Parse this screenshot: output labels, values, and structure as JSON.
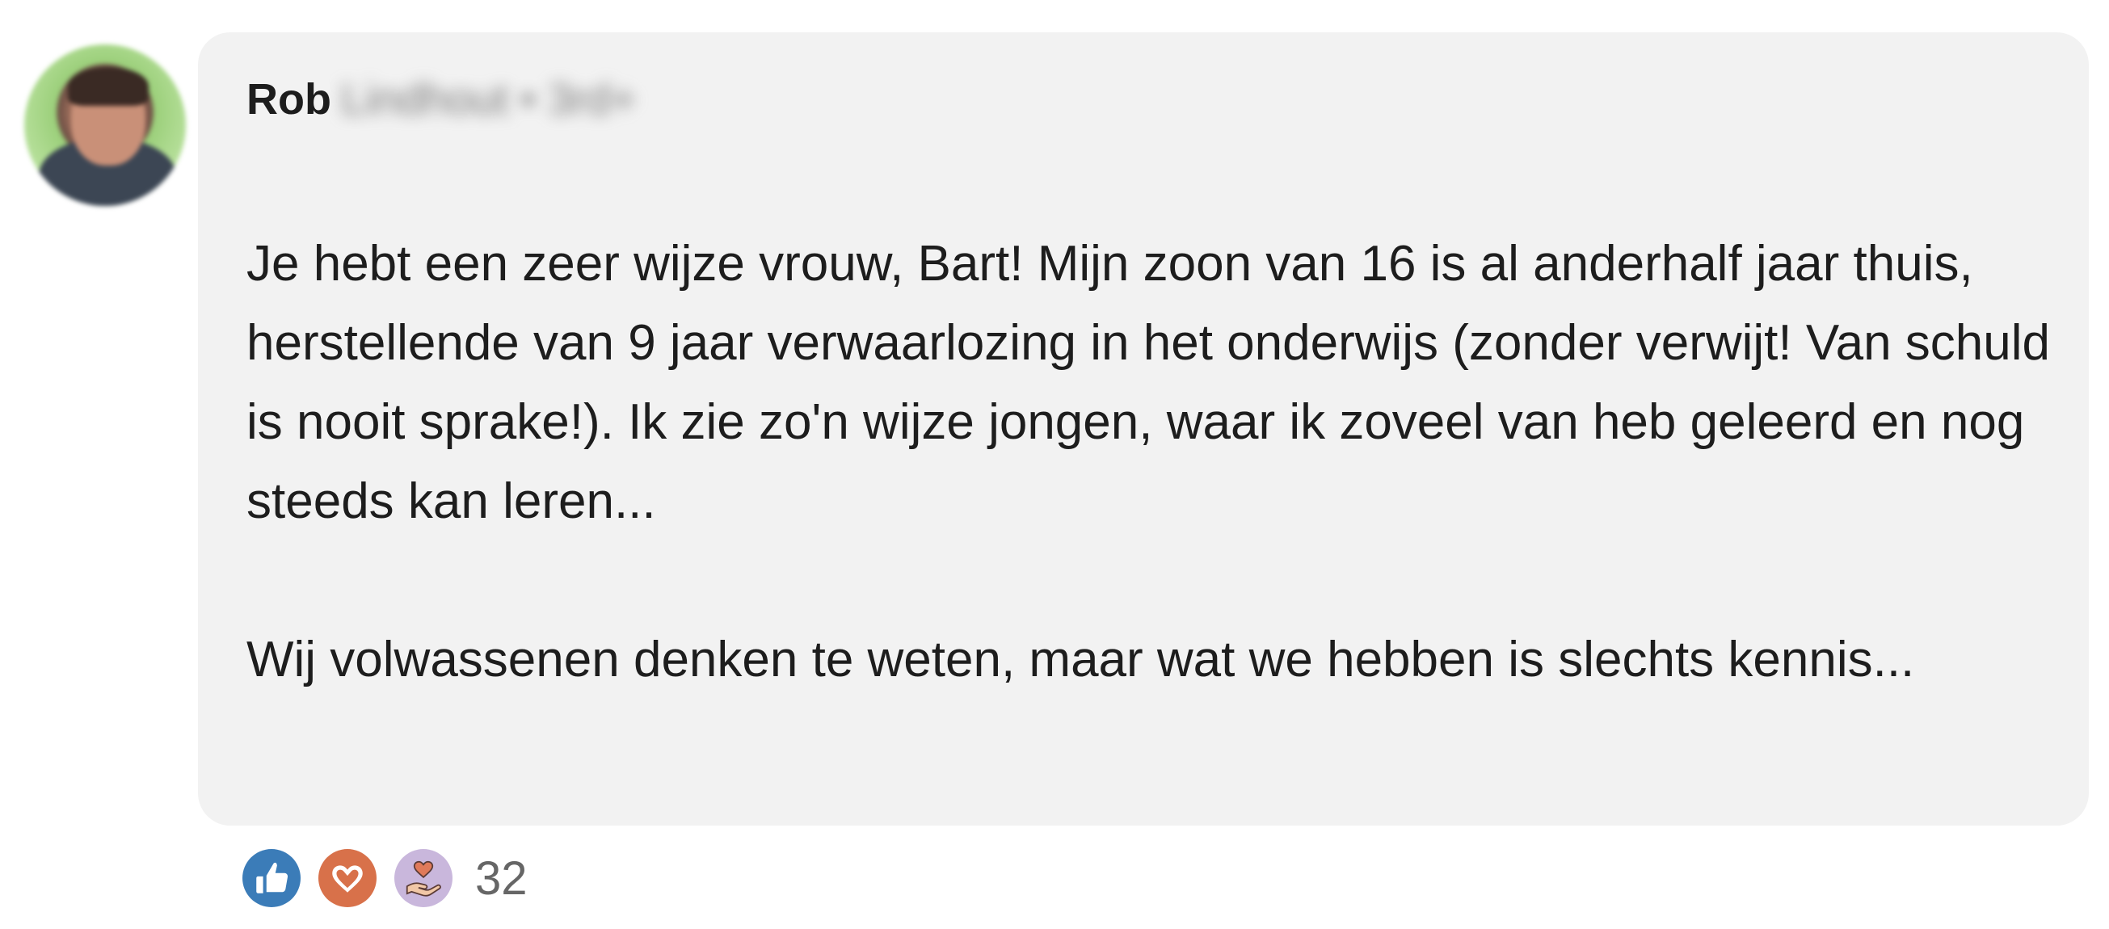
{
  "comment": {
    "author": {
      "first_name": "Rob",
      "rest_blurred": "Lindhout • 3rd+"
    },
    "paragraphs": [
      "Je hebt een zeer wijze vrouw, Bart! Mijn zoon van 16 is al anderhalf jaar thuis, herstellende van 9 jaar verwaarlozing in het onderwijs (zonder verwijt! Van schuld is nooit sprake!). Ik zie zo'n wijze jongen, waar ik zoveel van heb geleerd en nog steeds kan leren...",
      "Wij volwassenen denken te weten, maar wat we hebben is slechts kennis..."
    ],
    "reactions": {
      "icons": [
        "like-icon",
        "love-icon",
        "support-icon"
      ],
      "count": "32"
    }
  },
  "colors": {
    "bubble_background": "#f2f2f2",
    "like": "#3b7cb8",
    "love": "#d8714a",
    "support": "#c9b7dc",
    "count_text": "#666666"
  }
}
